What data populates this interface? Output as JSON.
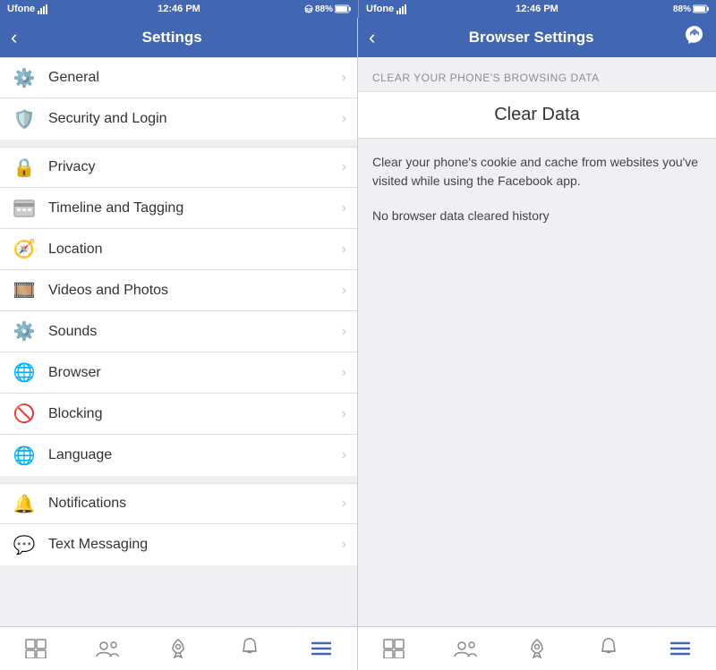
{
  "statusBar": {
    "left": {
      "carrier": "Ufone",
      "time": "12:46 PM",
      "icons": "📶 🔋 88%"
    },
    "right": {
      "carrier": "Ufone",
      "time": "12:46 PM",
      "icons": "📶 🔋 88%"
    }
  },
  "leftPanel": {
    "navTitle": "Settings",
    "sections": [
      {
        "items": [
          {
            "id": "general",
            "label": "General",
            "icon": "gear"
          },
          {
            "id": "security",
            "label": "Security and Login",
            "icon": "shield"
          }
        ]
      },
      {
        "items": [
          {
            "id": "privacy",
            "label": "Privacy",
            "icon": "lock"
          },
          {
            "id": "timeline",
            "label": "Timeline and Tagging",
            "icon": "calendar"
          },
          {
            "id": "location",
            "label": "Location",
            "icon": "location"
          },
          {
            "id": "videos",
            "label": "Videos and Photos",
            "icon": "film"
          },
          {
            "id": "sounds",
            "label": "Sounds",
            "icon": "settings"
          },
          {
            "id": "browser",
            "label": "Browser",
            "icon": "globe"
          },
          {
            "id": "blocking",
            "label": "Blocking",
            "icon": "block"
          },
          {
            "id": "language",
            "label": "Language",
            "icon": "world"
          }
        ]
      },
      {
        "items": [
          {
            "id": "notifications",
            "label": "Notifications",
            "icon": "bell"
          },
          {
            "id": "textmessaging",
            "label": "Text Messaging",
            "icon": "chat"
          }
        ]
      }
    ],
    "tabBar": {
      "items": [
        {
          "id": "feed",
          "label": "Feed",
          "active": false
        },
        {
          "id": "people",
          "label": "Friends",
          "active": false
        },
        {
          "id": "rocket",
          "label": "Activity",
          "active": false
        },
        {
          "id": "notifications",
          "label": "Notifications",
          "active": false
        },
        {
          "id": "menu",
          "label": "Menu",
          "active": true
        }
      ]
    }
  },
  "rightPanel": {
    "navTitle": "Browser Settings",
    "sectionHeaderLabel": "CLEAR YOUR PHONE'S BROWSING DATA",
    "clearDataButton": "Clear Data",
    "descriptionText": "Clear your phone's cookie and cache from websites you've visited while using the Facebook app.",
    "noDataText": "No browser data cleared history",
    "tabBar": {
      "items": [
        {
          "id": "feed",
          "label": "Feed",
          "active": false
        },
        {
          "id": "people",
          "label": "Friends",
          "active": false
        },
        {
          "id": "rocket",
          "label": "Activity",
          "active": false
        },
        {
          "id": "notifications",
          "label": "Notifications",
          "active": false
        },
        {
          "id": "menu",
          "label": "Menu",
          "active": true
        }
      ]
    }
  }
}
